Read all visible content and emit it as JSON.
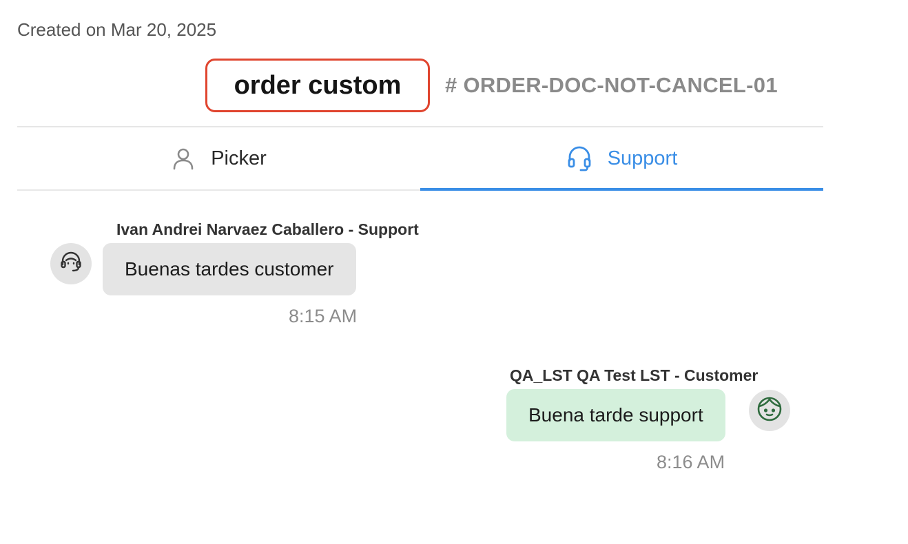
{
  "header": {
    "created": "Created on Mar 20, 2025",
    "title": "order custom",
    "order_id": "# ORDER-DOC-NOT-CANCEL-01",
    "title_border_color": "#e0452f"
  },
  "tabs": [
    {
      "label": "Picker",
      "icon": "person-icon",
      "active": false
    },
    {
      "label": "Support",
      "icon": "headset-icon",
      "active": true
    }
  ],
  "accent_color": "#3a8ee6",
  "messages": [
    {
      "sender": "Ivan Andrei Narvaez Caballero - Support",
      "text": "Buenas tardes customer",
      "time": "8:15 AM",
      "role": "support",
      "avatar_icon": "support-agent-icon",
      "bubble_color": "#e5e5e5"
    },
    {
      "sender": "QA_LST QA Test LST - Customer",
      "text": "Buena tarde support",
      "time": "8:16 AM",
      "role": "customer",
      "avatar_icon": "customer-face-icon",
      "bubble_color": "#d4f0dc"
    }
  ]
}
